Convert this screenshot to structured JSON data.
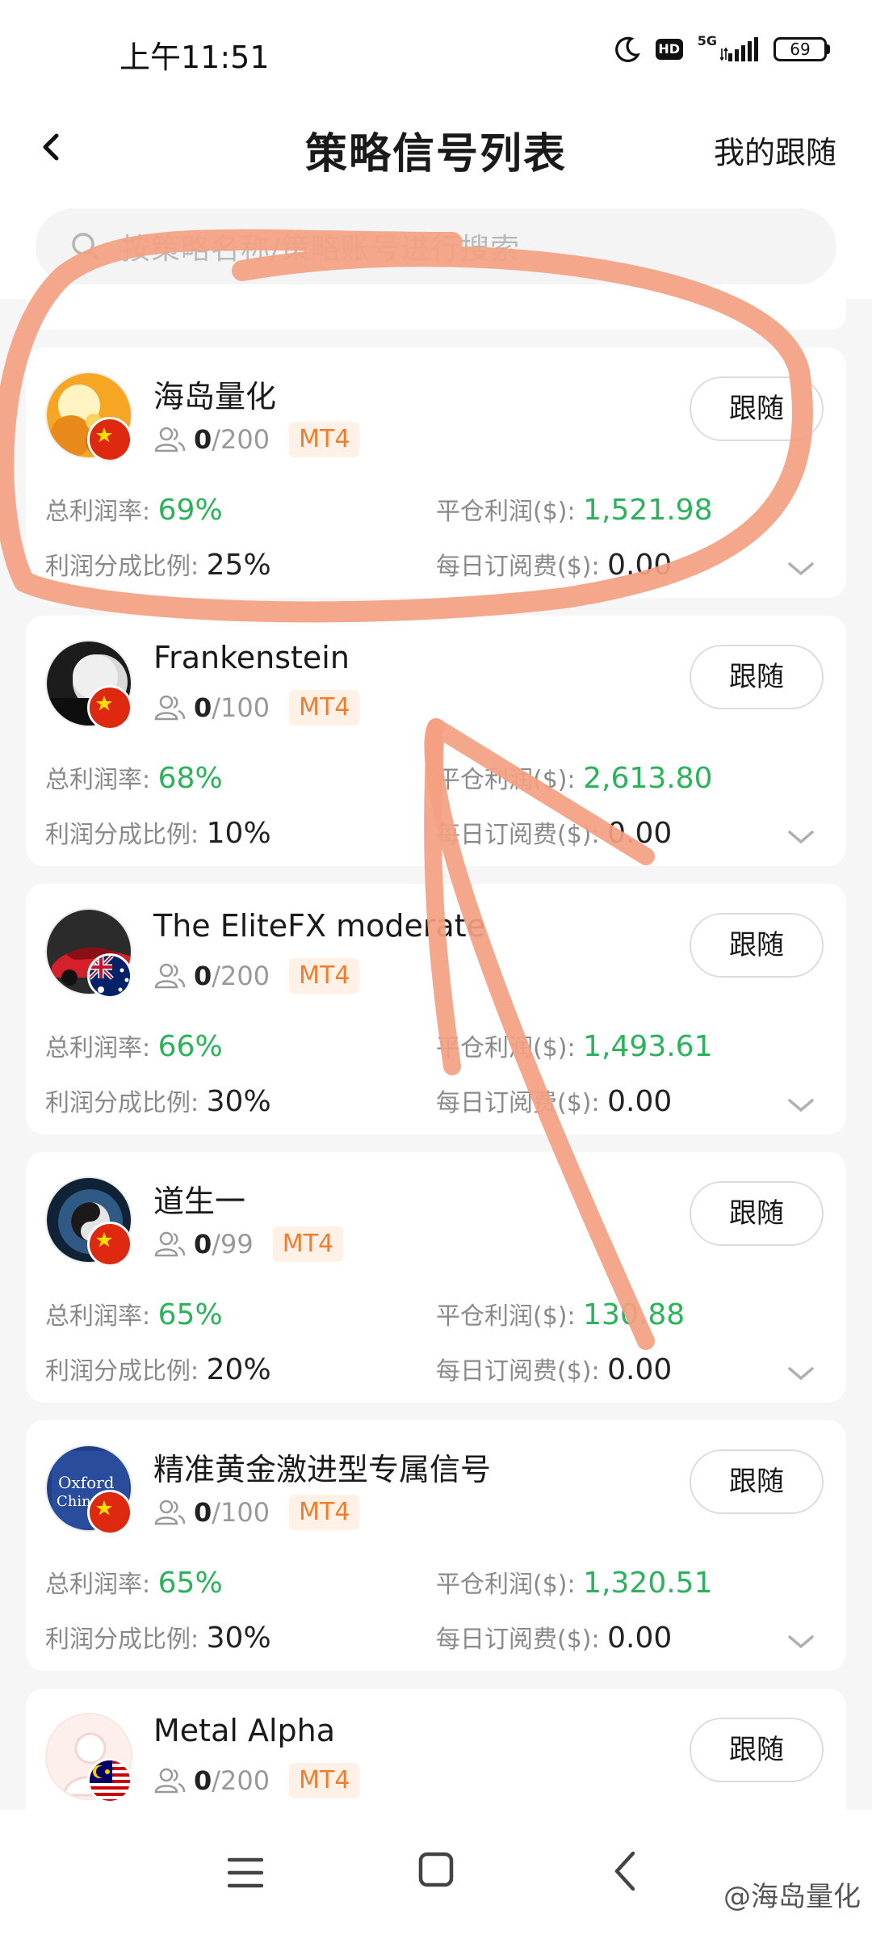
{
  "status_bar": {
    "time": "上午11:51",
    "hd": "HD",
    "network": "5G",
    "battery": "69"
  },
  "header": {
    "back_icon": "chevron-left-icon",
    "title": "策略信号列表",
    "right_link": "我的跟随"
  },
  "search": {
    "icon": "search-icon",
    "placeholder": "按策略名称/策略账号进行搜索"
  },
  "labels": {
    "total_profit_rate": "总利润率:",
    "close_profit": "平仓利润($):",
    "profit_share": "利润分成比例:",
    "daily_fee": "每日订阅费($):",
    "follow": "跟随"
  },
  "strategies": [
    {
      "name": "海岛量化",
      "followers": "0",
      "capacity": "/200",
      "platform": "MT4",
      "flag": "china",
      "total_profit_rate": "69%",
      "close_profit": "1,521.98",
      "profit_share": "25%",
      "daily_fee": "0.00"
    },
    {
      "name": "Frankenstein",
      "followers": "0",
      "capacity": "/100",
      "platform": "MT4",
      "flag": "china",
      "total_profit_rate": "68%",
      "close_profit": "2,613.80",
      "profit_share": "10%",
      "daily_fee": "0.00"
    },
    {
      "name": "The EliteFX moderate",
      "followers": "0",
      "capacity": "/200",
      "platform": "MT4",
      "flag": "australia",
      "total_profit_rate": "66%",
      "close_profit": "1,493.61",
      "profit_share": "30%",
      "daily_fee": "0.00"
    },
    {
      "name": "道生一",
      "followers": "0",
      "capacity": "/99",
      "platform": "MT4",
      "flag": "china",
      "total_profit_rate": "65%",
      "close_profit": "130.88",
      "profit_share": "20%",
      "daily_fee": "0.00"
    },
    {
      "name": "精准黄金激进型专属信号",
      "followers": "0",
      "capacity": "/100",
      "platform": "MT4",
      "flag": "china",
      "total_profit_rate": "65%",
      "close_profit": "1,320.51",
      "profit_share": "30%",
      "daily_fee": "0.00"
    },
    {
      "name": "Metal Alpha",
      "followers": "0",
      "capacity": "/200",
      "platform": "MT4",
      "flag": "malaysia"
    }
  ],
  "avatar_texts": {
    "book_line1": "Oxford",
    "book_line2": "Chinese"
  },
  "nav_bar": {
    "menu_icon": "menu-icon",
    "home_icon": "home-square-icon",
    "back_icon": "back-triangle-icon"
  },
  "watermark": "@海岛量化",
  "colors": {
    "profit_green": "#2ab35a",
    "badge_orange": "#f07c2e",
    "badge_bg": "#fff1e6",
    "annotation": "#f4a081"
  }
}
